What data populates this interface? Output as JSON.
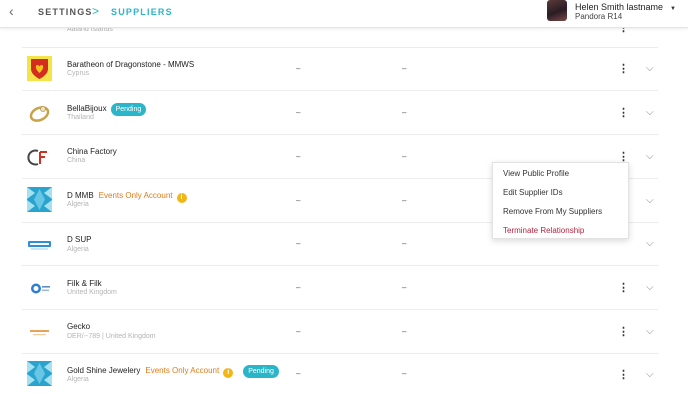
{
  "header": {
    "back_icon": "chevron-left-icon",
    "crumbs": [
      "SETTINGS",
      "SUPPLIERS"
    ],
    "separator": ">",
    "user": {
      "name": "Helen Smith lastname",
      "org": "Pandora R14",
      "caret": "▼"
    }
  },
  "suppliers": [
    {
      "name": "",
      "location": "Aaland Islands",
      "logo": "teal-triangles",
      "status": "",
      "events_only": "",
      "col1": "",
      "col2": ""
    },
    {
      "name": "Baratheon of Dragonstone - MMWS",
      "location": "Cyprus",
      "logo": "yellow-shield-heart",
      "status": "",
      "events_only": "",
      "col1": "–",
      "col2": "–"
    },
    {
      "name": "BellaBijoux",
      "location": "Thailand",
      "logo": "gold-ring",
      "status": "Pending",
      "events_only": "",
      "col1": "–",
      "col2": "–"
    },
    {
      "name": "China Factory",
      "location": "China",
      "logo": "cf-mark",
      "status": "",
      "events_only": "",
      "col1": "–",
      "col2": "–"
    },
    {
      "name": "D MMB",
      "location": "Algeria",
      "logo": "teal-triangles",
      "status": "",
      "events_only": "Events Only Account",
      "col1": "–",
      "col2": "–"
    },
    {
      "name": "D SUP",
      "location": "Algeria",
      "logo": "blue-wordmark",
      "status": "",
      "events_only": "",
      "col1": "–",
      "col2": "–"
    },
    {
      "name": "Filk & Filk",
      "location": "United Kingdom",
      "logo": "blue-circle-badge",
      "status": "",
      "events_only": "",
      "col1": "–",
      "col2": "–"
    },
    {
      "name": "Gecko",
      "location": "DER/--789 | United Kingdom",
      "logo": "orange-wordmark",
      "status": "",
      "events_only": "",
      "col1": "–",
      "col2": "–"
    },
    {
      "name": "Gold Shine Jewelery",
      "location": "Algeria",
      "logo": "teal-triangles",
      "status": "Pending",
      "events_only": "Events Only Account",
      "col1": "–",
      "col2": "–"
    }
  ],
  "row_actions": {
    "kebab": "⋮",
    "expand": "⌵",
    "info": "i"
  },
  "menu": {
    "items": [
      "View Public Profile",
      "Edit Supplier IDs",
      "Remove From My Suppliers",
      "Terminate Relationship"
    ]
  },
  "colors": {
    "accent": "#2bb5c8",
    "events": "#e07c18",
    "danger": "#b5253f",
    "info": "#f2b619"
  }
}
